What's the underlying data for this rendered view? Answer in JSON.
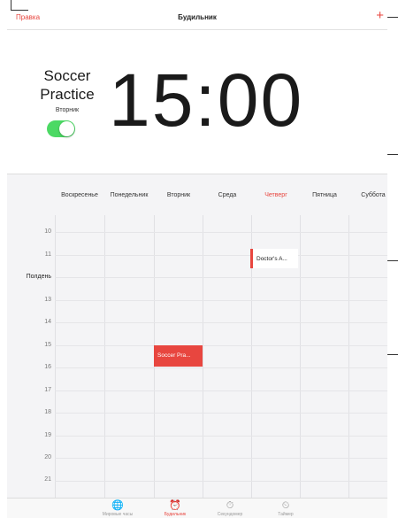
{
  "navbar": {
    "edit_label": "Правка",
    "title": "Будильник",
    "add_label": "+"
  },
  "alarm": {
    "name_line1": "Soccer",
    "name_line2": "Practice",
    "day": "Вторник",
    "time": "15:00",
    "enabled": true
  },
  "week": {
    "days": [
      "Воскресенье",
      "Понедельник",
      "Вторник",
      "Среда",
      "Четверг",
      "Пятница",
      "Суббота"
    ],
    "today_index": 4,
    "hours": [
      "10",
      "11",
      "Полдень",
      "13",
      "14",
      "15",
      "16",
      "17",
      "18",
      "19",
      "20",
      "21"
    ],
    "events": [
      {
        "title": "Doctor's A...",
        "day": "Четверг",
        "start": "11:00"
      },
      {
        "title": "Soccer Pra...",
        "day": "Вторник",
        "start": "15:00"
      }
    ]
  },
  "tabbar": {
    "items": [
      {
        "label": "Мировые часы",
        "icon": "globe-icon"
      },
      {
        "label": "Будильник",
        "icon": "alarm-clock-icon"
      },
      {
        "label": "Секундомер",
        "icon": "stopwatch-icon"
      },
      {
        "label": "Таймер",
        "icon": "timer-icon"
      }
    ],
    "active_index": 1
  },
  "colors": {
    "accent": "#e8463f",
    "toggle_on": "#4cd964"
  }
}
